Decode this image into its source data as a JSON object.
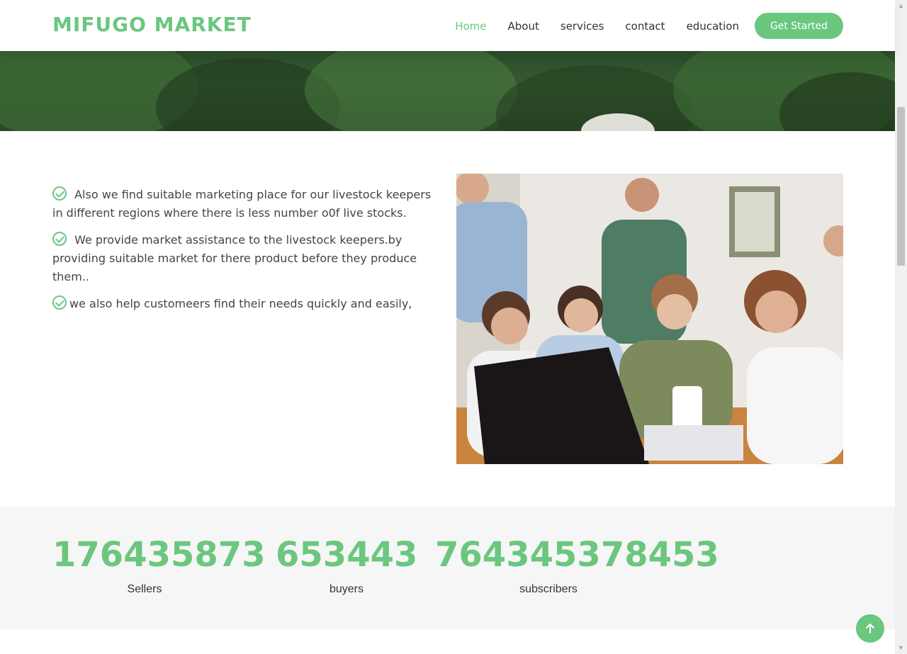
{
  "header": {
    "logo": "MIFUGO MARKET",
    "nav": [
      {
        "label": "Home",
        "active": true
      },
      {
        "label": "About",
        "active": false
      },
      {
        "label": "services",
        "active": false
      },
      {
        "label": "contact",
        "active": false
      },
      {
        "label": "education",
        "active": false
      }
    ],
    "cta_label": "Get Started"
  },
  "features": [
    {
      "icon": "check-circle-icon",
      "text": " Also we find suitable marketing place for our livestock keepers in different regions where there is less number o0f live stocks."
    },
    {
      "icon": "check-circle-icon",
      "text": " We provide market assistance to the livestock keepers.by providing suitable market for there product before they produce them.."
    },
    {
      "icon": "check-circle-icon",
      "text": "we also help customeers find their needs quickly and easily,"
    }
  ],
  "counts": [
    {
      "value": "176435873",
      "label": "Sellers"
    },
    {
      "value": "653443",
      "label": "buyers"
    },
    {
      "value": "764345378453",
      "label": "subscribers"
    }
  ],
  "colors": {
    "accent": "#6bc77e",
    "text": "#444444",
    "counts_bg": "#f6f6f6"
  },
  "back_to_top_icon": "arrow-up-icon"
}
